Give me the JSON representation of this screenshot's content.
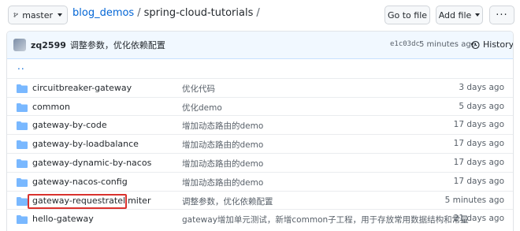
{
  "toolbar": {
    "branch": "master",
    "repo": "blog_demos",
    "path": "spring-cloud-tutorials",
    "goto_file": "Go to file",
    "add_file": "Add file",
    "more": "···"
  },
  "commit": {
    "author": "zq2599",
    "message": "调整参数，优化依赖配置",
    "sha": "e1c03dc",
    "time": "5 minutes ago",
    "history": "History"
  },
  "parent_dir": "..",
  "files": [
    {
      "name": "circuitbreaker-gateway",
      "message": "优化代码",
      "age": "3 days ago"
    },
    {
      "name": "common",
      "message": "优化demo",
      "age": "5 days ago"
    },
    {
      "name": "gateway-by-code",
      "message": "增加动态路由的demo",
      "age": "17 days ago"
    },
    {
      "name": "gateway-by-loadbalance",
      "message": "增加动态路由的demo",
      "age": "17 days ago"
    },
    {
      "name": "gateway-dynamic-by-nacos",
      "message": "增加动态路由的demo",
      "age": "17 days ago"
    },
    {
      "name": "gateway-nacos-config",
      "message": "增加动态路由的demo",
      "age": "17 days ago"
    },
    {
      "name": "gateway-requestratelimiter",
      "message": "调整参数，优化依赖配置",
      "age": "5 minutes ago"
    },
    {
      "name": "hello-gateway",
      "message": "gateway增加单元测试，新增common子工程，用于存放常用数据结构和常量",
      "age": "21 days ago"
    }
  ],
  "colors": {
    "link": "#0366d6",
    "folder": "#79b8ff",
    "highlight_box": "#d9322e"
  }
}
